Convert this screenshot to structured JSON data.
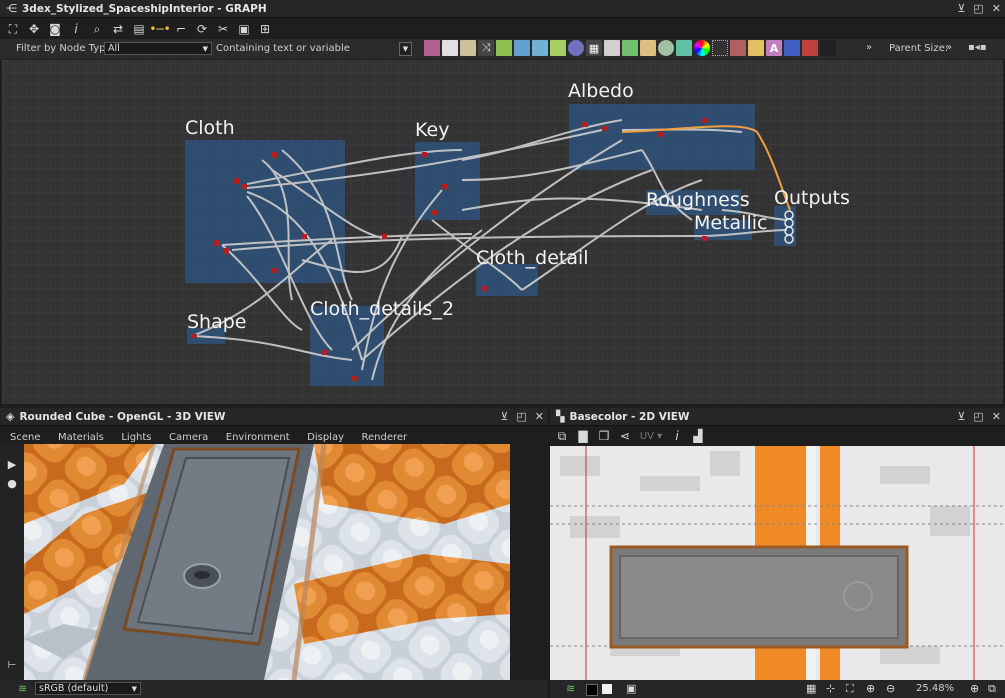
{
  "graph_panel": {
    "title": "3dex_Stylized_SpaceshipInterior - GRAPH",
    "filter_label": "Filter by Node Type",
    "filter_value": "All",
    "search_placeholder": "Containing text or variable",
    "parent_size_label": "Parent Size:",
    "frames": [
      {
        "label": "Cloth"
      },
      {
        "label": "Key"
      },
      {
        "label": "Albedo"
      },
      {
        "label": "Roughness"
      },
      {
        "label": "Metallic"
      },
      {
        "label": "Outputs"
      },
      {
        "label": "Cloth_detail"
      },
      {
        "label": "Cloth_details_2"
      },
      {
        "label": "Shape"
      }
    ]
  },
  "view3d_panel": {
    "title": "Rounded Cube - OpenGL - 3D VIEW",
    "menu": [
      "Scene",
      "Materials",
      "Lights",
      "Camera",
      "Environment",
      "Display",
      "Renderer"
    ],
    "colorspace": "sRGB (default)"
  },
  "view2d_panel": {
    "title": "Basecolor - 2D VIEW",
    "uv_label": "UV",
    "zoom": "25.48%"
  },
  "colors": {
    "frame": "#2e5480",
    "accent": "#f0a040",
    "orange_stripe": "#f08a24"
  }
}
